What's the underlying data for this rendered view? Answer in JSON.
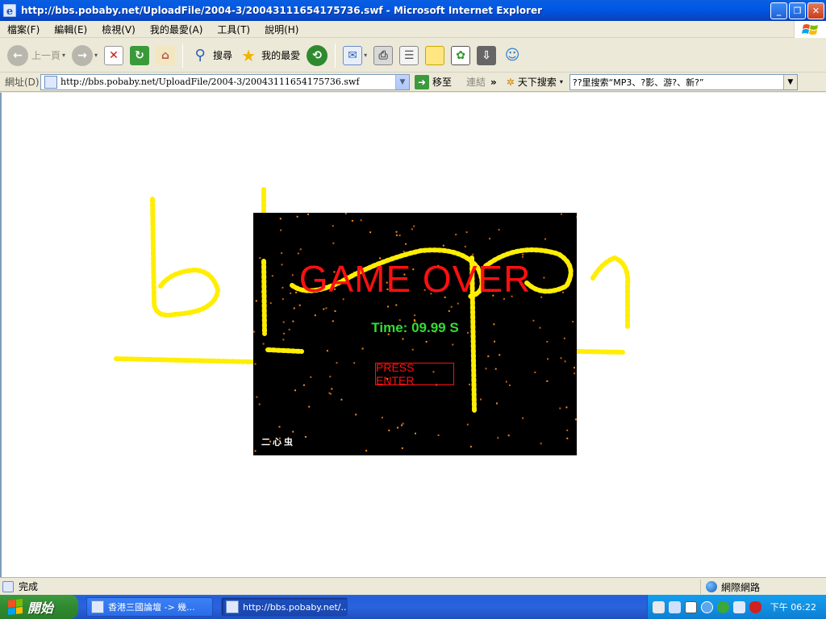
{
  "window": {
    "title": "http://bbs.pobaby.net/UploadFile/2004-3/20043111654175736.swf - Microsoft Internet Explorer",
    "minimize": "_",
    "restore": "❐",
    "close": "✕"
  },
  "menu": {
    "items": [
      "檔案(F)",
      "編輯(E)",
      "檢視(V)",
      "我的最愛(A)",
      "工具(T)",
      "說明(H)"
    ]
  },
  "toolbar": {
    "back_label": "上一頁",
    "search_label": "搜尋",
    "favorites_label": "我的最愛"
  },
  "address": {
    "label": "網址(D)",
    "url": "http://bbs.pobaby.net/UploadFile/2004-3/20043111654175736.swf",
    "go_label": "移至",
    "links_label": "連結",
    "search_engine_label": "天下搜索",
    "search_combo_text": "??里搜索“MP3、?影、游?、新?”"
  },
  "game": {
    "title": "GAME OVER",
    "time_label": "Time:",
    "time_value": "09.99 S",
    "press_enter": "PRESS ENTER",
    "author": "二心虫"
  },
  "statusbar": {
    "status_text": "完成",
    "zone_text": "網際網路"
  },
  "taskbar": {
    "start_label": "開始",
    "tasks": [
      "香港三國論壇 -> 幾...",
      "http://bbs.pobaby.net/..."
    ],
    "clock": "下午 06:22"
  },
  "colors": {
    "game_title": "#ff1010",
    "time_text": "#33dd33",
    "scribble": "#ffee00"
  }
}
